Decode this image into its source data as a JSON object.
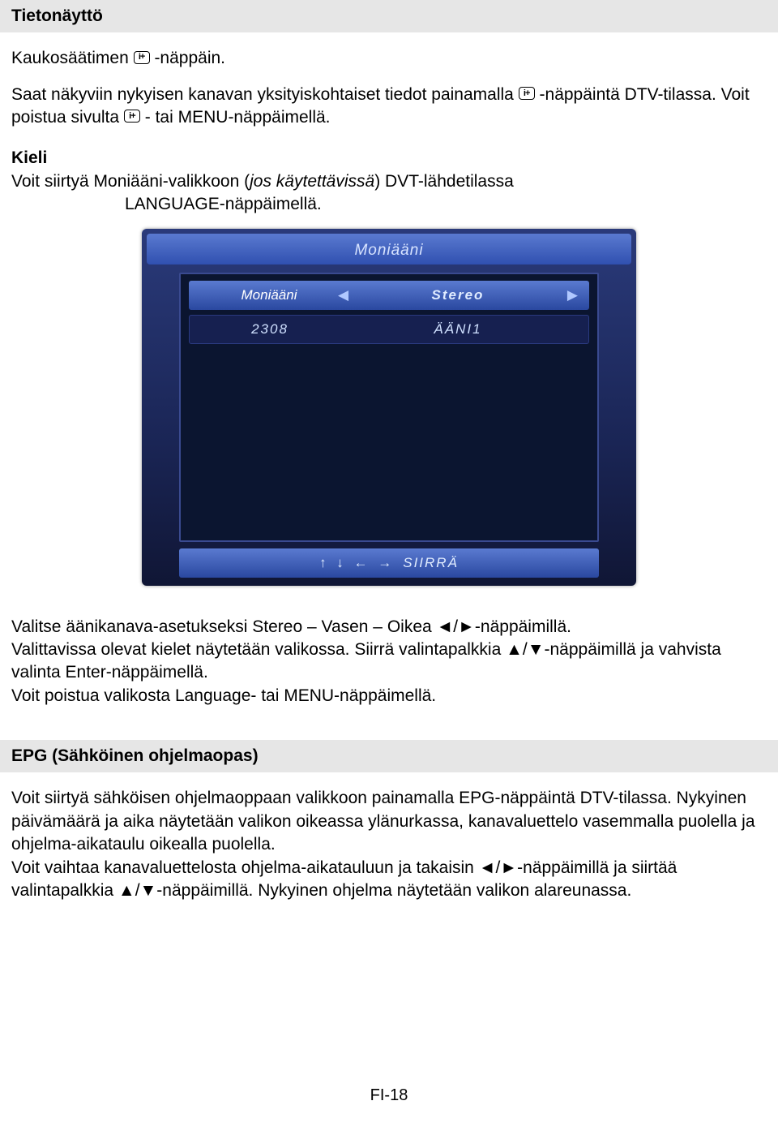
{
  "section1": {
    "title": "Tietonäyttö",
    "line1a": "Kaukosäätimen ",
    "line1b": "-näppäin.",
    "line2a": "Saat näkyviin nykyisen kanavan yksityiskohtaiset tiedot painamalla ",
    "line2b": "-näppäintä DTV-tilassa. Voit poistua sivulta ",
    "line2c": "- tai MENU-näppäimellä."
  },
  "section2": {
    "title": "Kieli",
    "line1a": "Voit siirtyä Moniääni-valikkoon (",
    "line1b": "jos käytettävissä",
    "line1c": ") DVT-lähdetilassa",
    "line2": "LANGUAGE-näppäimellä."
  },
  "tv": {
    "header": "Moniääni",
    "row1_label": "Moniääni",
    "row1_value": "Stereo",
    "row2_code": "2308",
    "row2_label": "ÄÄNI1",
    "footer_arrows": "↑ ↓ ← →",
    "footer_label": "SIIRRÄ"
  },
  "afterImage": {
    "p1": "Valitse äänikanava-asetukseksi Stereo – Vasen – Oikea ◄/►-näppäimillä.",
    "p2": "Valittavissa olevat kielet näytetään valikossa. Siirrä valintapalkkia ▲/▼-näppäimillä ja vahvista valinta Enter-näppäimellä.",
    "p3": "Voit poistua valikosta Language- tai MENU-näppäimellä."
  },
  "section3": {
    "title": "EPG (Sähköinen ohjelmaopas)",
    "p1": "Voit siirtyä sähköisen ohjelmaoppaan valikkoon painamalla EPG-näppäintä DTV-tilassa. Nykyinen päivämäärä ja aika näytetään valikon oikeassa ylänurkassa, kanavaluettelo vasemmalla puolella ja ohjelma-aikataulu oikealla puolella.",
    "p2": "Voit vaihtaa kanavaluettelosta ohjelma-aikatauluun ja takaisin ◄/►-näppäimillä ja siirtää valintapalkkia ▲/▼-näppäimillä. Nykyinen ohjelma näytetään valikon alareunassa."
  },
  "icon": "i+",
  "pageNum": "FI-18"
}
